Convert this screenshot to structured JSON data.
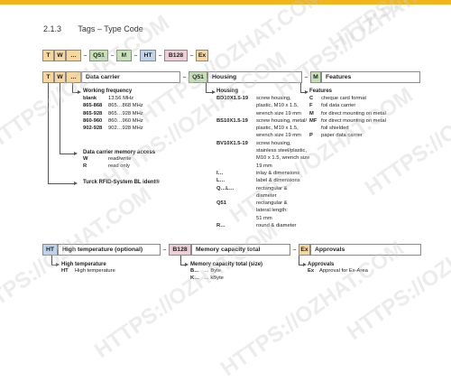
{
  "section": {
    "number": "2.1.3",
    "title": "Tags – Type Code"
  },
  "top_code": [
    "T",
    "W",
    "…",
    "–",
    "Q51",
    "–",
    "M",
    "–",
    "HT",
    "–",
    "B128",
    "–",
    "Ex"
  ],
  "row1": {
    "t": "T",
    "w": "W",
    "dots": "…",
    "carrier_label": "Data carrier",
    "q51": "Q51",
    "housing_label": "Housing",
    "m": "M",
    "features_label": "Features"
  },
  "working_frequency": {
    "title": "Working frequency",
    "items": [
      {
        "k": "blank",
        "v": "13.56 MHz"
      },
      {
        "k": "865-868",
        "v": "865…868 MHz"
      },
      {
        "k": "865-928",
        "v": "865…928 MHz"
      },
      {
        "k": "860-960",
        "v": "860…960 MHz"
      },
      {
        "k": "902-928",
        "v": "902…928 MHz"
      }
    ]
  },
  "memory_access": {
    "title": "Data carrier memory access",
    "items": [
      {
        "k": "W",
        "v": "read/write"
      },
      {
        "k": "R",
        "v": "read only"
      }
    ]
  },
  "turck": {
    "title": "Turck RFID-System BL ident®"
  },
  "housing": {
    "title": "Housing",
    "items": [
      {
        "k": "BD10X1.5-19",
        "v": [
          "screw housing,",
          "plastic, M10 x 1.5,",
          "wrench size 19 mm"
        ]
      },
      {
        "k": "BS10X1.5-19",
        "v": [
          "screw housing, metal/",
          "plastic, M10 x 1.5,",
          "wrench size 19 mm"
        ]
      },
      {
        "k": "BV10X1.5-19",
        "v": [
          "screw housing,",
          "stainless steel/plastic,",
          "M10 x 1.5, wrench size",
          "19 mm"
        ]
      },
      {
        "k": "I…",
        "v": [
          "inlay & dimensions"
        ]
      },
      {
        "k": "L…",
        "v": [
          "label & dimensions"
        ]
      },
      {
        "k": "Q…L…",
        "v": [
          "rectangular &",
          "diameter"
        ]
      },
      {
        "k": "Q51",
        "v": [
          "rectangular &",
          "lateral length:",
          "51 mm"
        ]
      },
      {
        "k": "R…",
        "v": [
          "round & diameter"
        ]
      }
    ]
  },
  "features": {
    "title": "Features",
    "items": [
      {
        "k": "C",
        "v": [
          "cheque card format"
        ]
      },
      {
        "k": "F",
        "v": [
          "foil data carrier"
        ]
      },
      {
        "k": "M",
        "v": [
          "for direct mounting on metal"
        ]
      },
      {
        "k": "MF",
        "v": [
          "for direct mounting on metal",
          "foil shielded"
        ]
      },
      {
        "k": "P",
        "v": [
          "paper data carrier"
        ]
      }
    ]
  },
  "row2": {
    "ht": "HT",
    "ht_label": "High temperature (optional)",
    "b128": "B128",
    "mem_label": "Memory capacity total",
    "ex": "Ex",
    "approvals_label": "Approvals"
  },
  "high_temp": {
    "title": "High temperature",
    "items": [
      {
        "k": "HT",
        "v": "High temperature"
      }
    ]
  },
  "memory_total": {
    "title": "Memory capacity total (size)",
    "items": [
      {
        "k": "B…",
        "v": "… Byte"
      },
      {
        "k": "K…",
        "v": "… kByte"
      }
    ]
  },
  "approvals": {
    "title": "Approvals",
    "items": [
      {
        "k": "Ex",
        "v": "Approval for Ex-Area"
      }
    ]
  },
  "watermark": "HTTPS://OZHAT.COM",
  "colors": {
    "accent": "#f2b418",
    "orange": "#f7d7a0",
    "green": "#c7e2b6",
    "pink": "#eecfd7",
    "blue": "#bdd4ec"
  }
}
